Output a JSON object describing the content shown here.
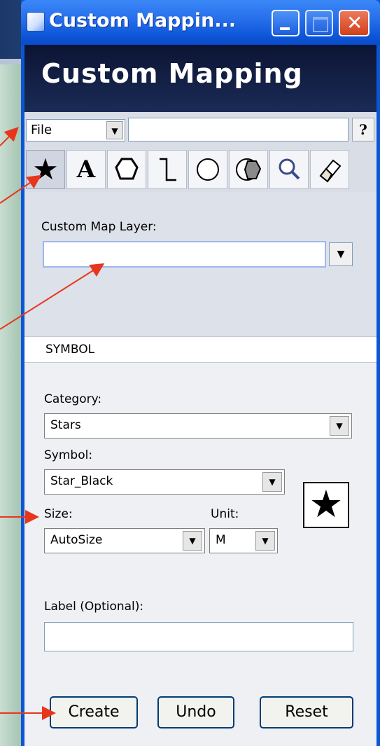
{
  "window": {
    "title": "Custom Mappin...",
    "minimize_icon": "minimize-icon",
    "maximize_icon": "maximize-icon",
    "close_icon": "close-icon"
  },
  "header": {
    "title": "Custom Mapping"
  },
  "file_menu": {
    "value": "File",
    "help_label": "?"
  },
  "tools": [
    {
      "name": "star-tool",
      "icon": "★"
    },
    {
      "name": "text-tool",
      "icon": "A"
    },
    {
      "name": "polygon-tool",
      "icon": "⬡"
    },
    {
      "name": "line-tool",
      "icon": "⌐"
    },
    {
      "name": "circle-tool",
      "icon": "○"
    },
    {
      "name": "shape-fill-tool",
      "icon": "⬢"
    },
    {
      "name": "zoom-tool",
      "icon": "🔍"
    },
    {
      "name": "eraser-tool",
      "icon": "⌫"
    }
  ],
  "layer": {
    "label": "Custom Map Layer:",
    "value": ""
  },
  "section": {
    "title": "SYMBOL"
  },
  "category": {
    "label": "Category:",
    "value": "Stars"
  },
  "symbol": {
    "label": "Symbol:",
    "value": "Star_Black",
    "preview": "★"
  },
  "size": {
    "label": "Size:",
    "value": "AutoSize"
  },
  "unit": {
    "label": "Unit:",
    "value": "M"
  },
  "label_field": {
    "label": "Label (Optional):",
    "value": ""
  },
  "buttons": {
    "create": "Create",
    "undo": "Undo",
    "reset": "Reset"
  },
  "colors": {
    "titlebar": "#2870ec",
    "header_bg": "#0f1b3d",
    "close_button": "#e2452b",
    "annotation_arrow": "#e8361c",
    "field_border": "#7f9db9",
    "focus_border": "#9db7ee"
  }
}
